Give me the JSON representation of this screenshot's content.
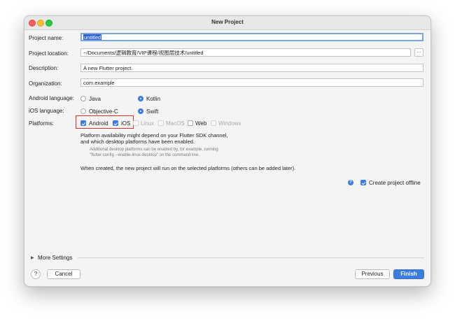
{
  "window": {
    "title": "New Project"
  },
  "form": {
    "project_name": {
      "label": "Project name:",
      "value": "untitled"
    },
    "project_location": {
      "label": "Project location:",
      "value": "~/Documents/逻辑教育/VIP课程/视图层技术/untitled",
      "browse_label": "..."
    },
    "description": {
      "label": "Description:",
      "value": "A new Flutter project."
    },
    "organization": {
      "label": "Organization:",
      "value": "com.example"
    },
    "android_language": {
      "label": "Android language:",
      "options": [
        "Java",
        "Kotlin"
      ],
      "selected": "Kotlin"
    },
    "ios_language": {
      "label": "iOS language:",
      "options": [
        "Objective-C",
        "Swift"
      ],
      "selected": "Swift"
    },
    "platforms": {
      "label": "Platforms:",
      "options": [
        {
          "label": "Android",
          "checked": true,
          "enabled": true
        },
        {
          "label": "iOS",
          "checked": true,
          "enabled": true
        },
        {
          "label": "Linux",
          "checked": false,
          "enabled": false
        },
        {
          "label": "MacOS",
          "checked": false,
          "enabled": false
        },
        {
          "label": "Web",
          "checked": false,
          "enabled": true
        },
        {
          "label": "Windows",
          "checked": false,
          "enabled": false
        }
      ],
      "note_line1": "Platform availability might depend on your Flutter SDK channel,",
      "note_line2": "and which desktop platforms have been enabled.",
      "small_line1": "Additional desktop platforms can be enabled by, for example, running",
      "small_line2": "\"flutter config --enable-linux-desktop\" on the command line.",
      "run_note": "When created, the new project will run on the selected platforms (others can be added later)."
    },
    "create_offline": {
      "label": "Create project offline",
      "checked": true
    }
  },
  "footer": {
    "more_settings": "More Settings",
    "help": "?",
    "cancel": "Cancel",
    "previous": "Previous",
    "finish": "Finish"
  },
  "colors": {
    "accent": "#3c7be0",
    "highlight_border": "#d8302b"
  },
  "icons": {
    "help": "question-circle-icon",
    "chevron": "chevron-right-icon",
    "info": "info-icon"
  }
}
